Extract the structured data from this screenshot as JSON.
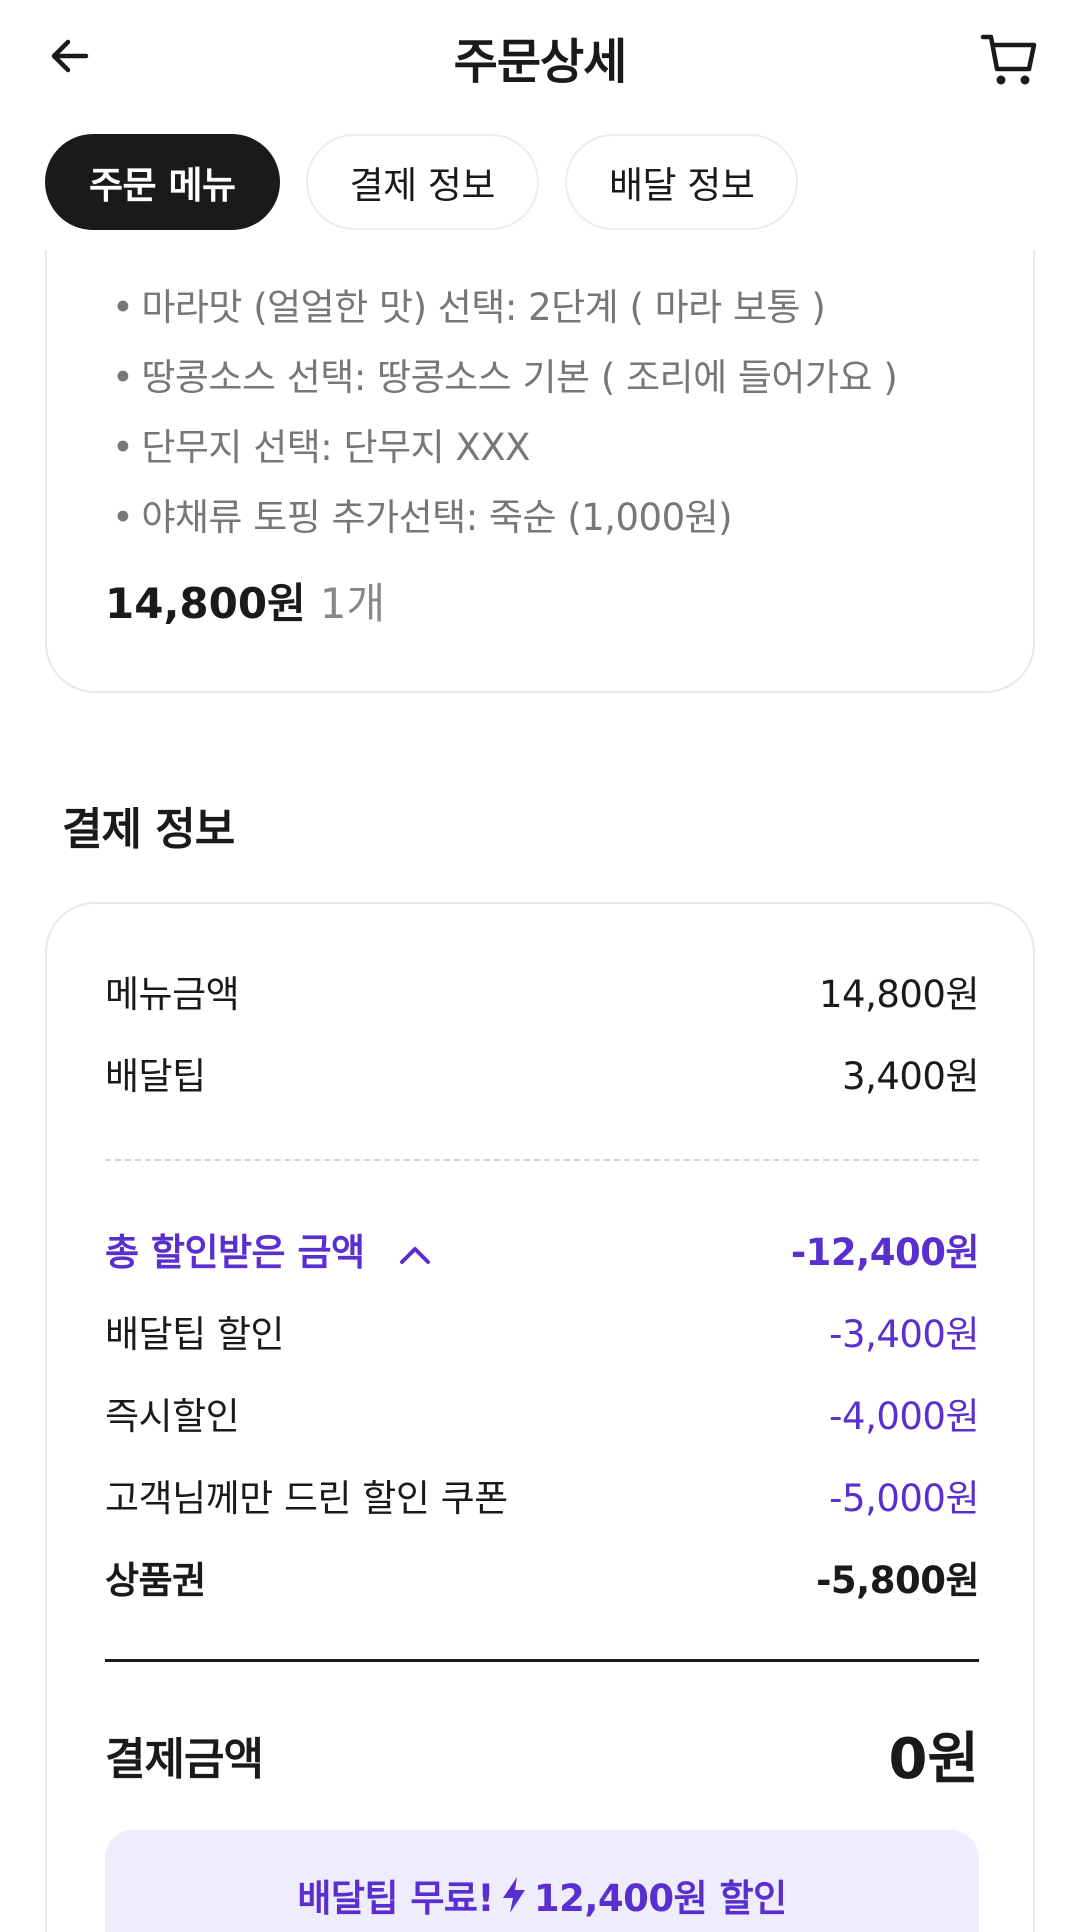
{
  "header": {
    "title": "주문상세",
    "back_icon": "arrow-left-icon",
    "cart_icon": "cart-icon"
  },
  "tabs": [
    {
      "label": "주문 메뉴",
      "active": true
    },
    {
      "label": "결제 정보",
      "active": false
    },
    {
      "label": "배달 정보",
      "active": false
    }
  ],
  "menu": {
    "options": [
      "마라맛 (얼얼한 맛) 선택: 2단계 ( 마라 보통 )",
      "땅콩소스 선택: 땅콩소스 기본 ( 조리에 들어가요 )",
      "단무지 선택: 단무지 XXX",
      "야채류 토핑 추가선택: 죽순 (1,000원)"
    ],
    "price": "14,800원",
    "quantity": "1개"
  },
  "payment": {
    "section_title": "결제 정보",
    "menu_amount_label": "메뉴금액",
    "menu_amount": "14,800원",
    "delivery_tip_label": "배달팁",
    "delivery_tip": "3,400원",
    "total_discount_label": "총 할인받은 금액",
    "total_discount": "-12,400원",
    "delivery_tip_discount_label": "배달팁 할인",
    "delivery_tip_discount": "-3,400원",
    "instant_discount_label": "즉시할인",
    "instant_discount": "-4,000원",
    "coupon_label": "고객님께만 드린 할인 쿠폰",
    "coupon": "-5,000원",
    "gift_card_label": "상품권",
    "gift_card": "-5,800원",
    "total_label": "결제금액",
    "total": "0원",
    "promo_left": "배달팁 무료!",
    "promo_right": "12,400원 할인"
  },
  "colors": {
    "accent": "#5a2fcf",
    "promo_bg": "#efedfc",
    "dark": "#1a1a1a"
  }
}
